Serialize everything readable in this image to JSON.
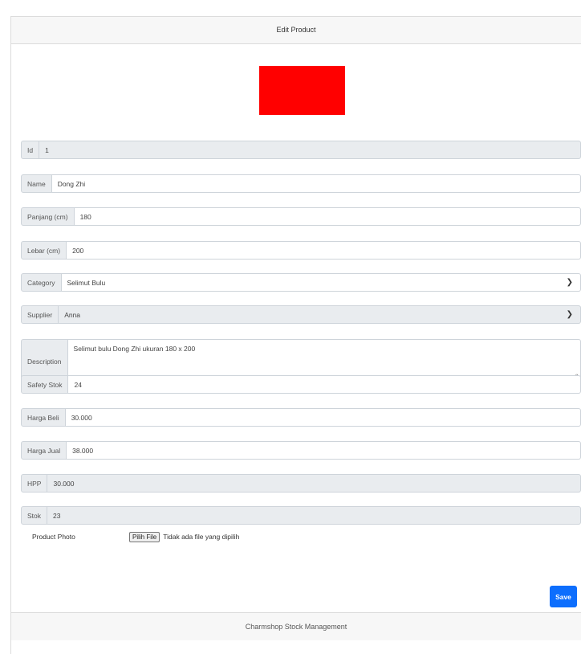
{
  "header": {
    "title": "Edit Product"
  },
  "product_photo": {
    "color": "#ff0000"
  },
  "form": {
    "id": {
      "label": "Id",
      "value": "1"
    },
    "name": {
      "label": "Name",
      "value": "Dong Zhi"
    },
    "panjang": {
      "label": "Panjang (cm)",
      "value": "180"
    },
    "lebar": {
      "label": "Lebar (cm)",
      "value": "200"
    },
    "category": {
      "label": "Category",
      "value": "Selimut Bulu"
    },
    "supplier": {
      "label": "Supplier",
      "value": "Anna"
    },
    "description": {
      "label": "Description",
      "value": "Selimut bulu Dong Zhi ukuran 180 x 200"
    },
    "safety_stok": {
      "label": "Safety Stok",
      "value": "24"
    },
    "harga_beli": {
      "label": "Harga Beli",
      "value": "30.000"
    },
    "harga_jual": {
      "label": "Harga Jual",
      "value": "38.000"
    },
    "hpp": {
      "label": "HPP",
      "value": "30.000"
    },
    "stok": {
      "label": "Stok",
      "value": "23"
    },
    "photo": {
      "label": "Product Photo",
      "button": "Pilih File",
      "status": "Tidak ada file yang dipilih"
    }
  },
  "actions": {
    "save_label": "Save"
  },
  "footer": {
    "text": "Charmshop Stock Management"
  },
  "colors": {
    "primary": "#0d6efd",
    "readonly_bg": "#e9ecef"
  }
}
